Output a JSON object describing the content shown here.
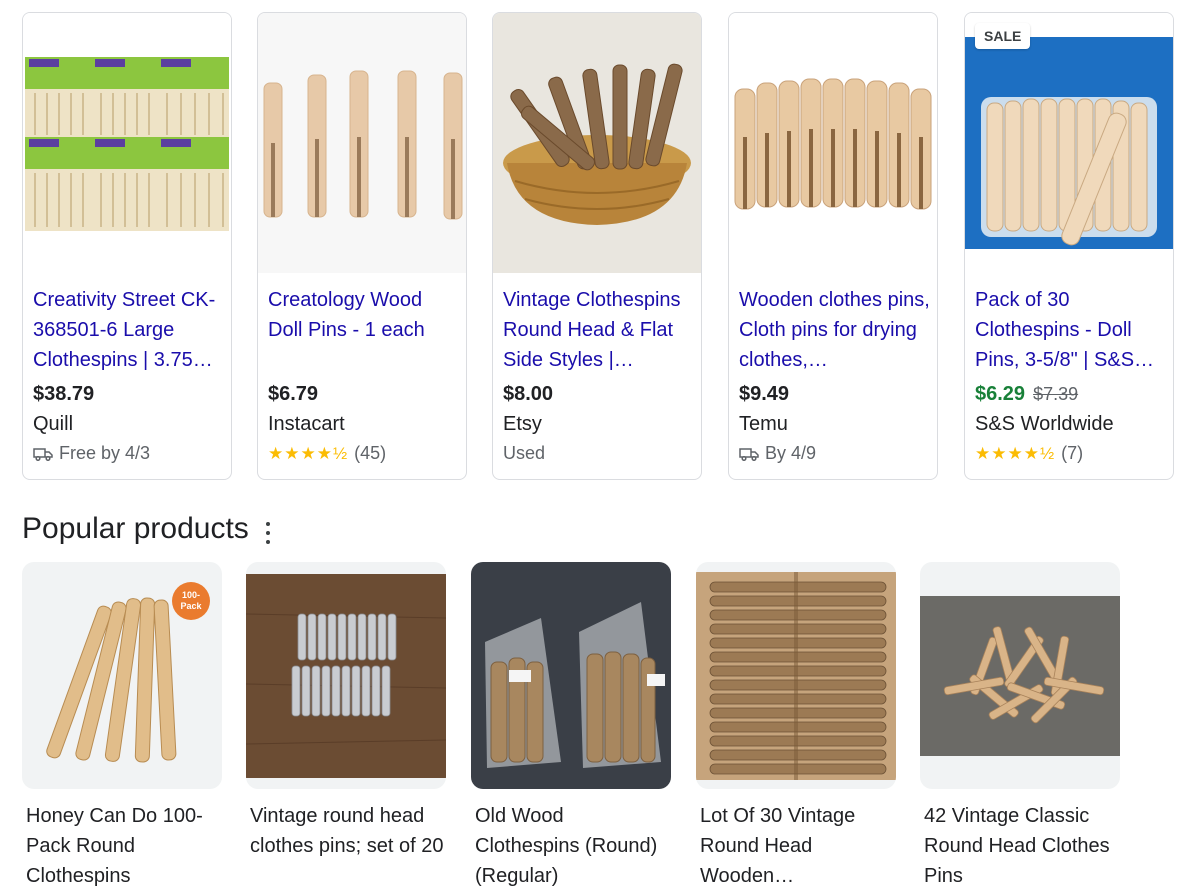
{
  "cards": [
    {
      "title": "Creativity Street CK-368501-6 Large Clothespins | 3.75…",
      "price": "$38.79",
      "store": "Quill",
      "meta_type": "delivery",
      "delivery": "Free by 4/3",
      "image_icon": "packaged-clothespins-image"
    },
    {
      "title": "Creatology Wood Doll Pins - 1 each",
      "price": "$6.79",
      "store": "Instacart",
      "meta_type": "rating",
      "stars": "★★★★½",
      "rating_value": 4.5,
      "review_count": "(45)",
      "image_icon": "doll-pins-image"
    },
    {
      "title": "Vintage Clothespins Round Head & Flat Side Styles |…",
      "price": "$8.00",
      "store": "Etsy",
      "meta_type": "condition",
      "condition": "Used",
      "image_icon": "clothespins-basket-image"
    },
    {
      "title": "Wooden clothes pins, Cloth pins for drying clothes,…",
      "price": "$9.49",
      "store": "Temu",
      "meta_type": "delivery",
      "delivery": "By 4/9",
      "image_icon": "clothespins-row-image"
    },
    {
      "title": "Pack of 30 Clothespins - Doll Pins, 3-5/8\" | S&S…",
      "price": "$6.29",
      "old_price": "$7.39",
      "sale_badge": "SALE",
      "store": "S&S Worldwide",
      "meta_type": "rating",
      "stars": "★★★★½",
      "rating_value": 4.5,
      "review_count": "(7)",
      "image_icon": "clothespins-bag-image"
    }
  ],
  "popular": {
    "heading": "Popular products",
    "more_icon": "more-vert-icon",
    "items": [
      {
        "title": "Honey Can Do 100-Pack Round Clothespins",
        "badge": "100-Pack"
      },
      {
        "title": "Vintage round head clothes pins; set of 20"
      },
      {
        "title": "Old Wood Clothespins (Round) (Regular)"
      },
      {
        "title": "Lot Of 30 Vintage Round Head Wooden…"
      },
      {
        "title": "42 Vintage Classic Round Head Clothes Pins"
      }
    ]
  },
  "colors": {
    "link": "#1a0dab",
    "sale_price": "#188038",
    "star": "#fbbc04",
    "border": "#dadce0"
  }
}
